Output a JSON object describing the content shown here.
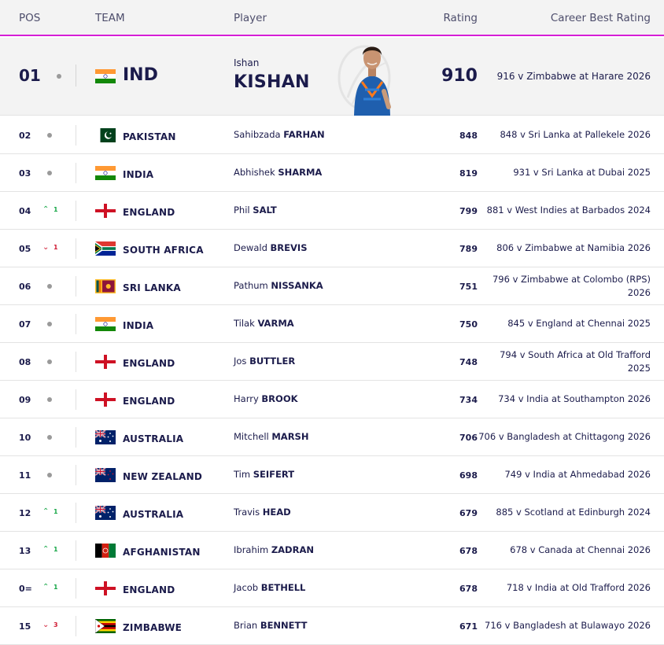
{
  "header": {
    "pos": "POS",
    "team": "TEAM",
    "player": "Player",
    "rating": "Rating",
    "best": "Career Best Rating"
  },
  "top": {
    "pos": "01",
    "team": "IND",
    "first": "Ishan",
    "last": "KISHAN",
    "rating": "910",
    "best": "916 v Zimbabwe at Harare 2026",
    "flag": "india"
  },
  "rows": [
    {
      "pos": "02",
      "move": "none",
      "change": "",
      "team": "PAKISTAN",
      "flag": "pakistan",
      "first": "Sahibzada",
      "last": "FARHAN",
      "rating": "848",
      "best": "848 v Sri Lanka at Pallekele 2026"
    },
    {
      "pos": "03",
      "move": "none",
      "change": "",
      "team": "INDIA",
      "flag": "india",
      "first": "Abhishek",
      "last": "SHARMA",
      "rating": "819",
      "best": "931 v Sri Lanka at Dubai 2025"
    },
    {
      "pos": "04",
      "move": "up",
      "change": "1",
      "team": "ENGLAND",
      "flag": "england",
      "first": "Phil",
      "last": "SALT",
      "rating": "799",
      "best": "881 v West Indies at Barbados 2024"
    },
    {
      "pos": "05",
      "move": "down",
      "change": "1",
      "team": "SOUTH AFRICA",
      "flag": "south-africa",
      "first": "Dewald",
      "last": "BREVIS",
      "rating": "789",
      "best": "806 v Zimbabwe at Namibia 2026"
    },
    {
      "pos": "06",
      "move": "none",
      "change": "",
      "team": "SRI LANKA",
      "flag": "sri-lanka",
      "first": "Pathum",
      "last": "NISSANKA",
      "rating": "751",
      "best": "796 v Zimbabwe at Colombo (RPS) 2026"
    },
    {
      "pos": "07",
      "move": "none",
      "change": "",
      "team": "INDIA",
      "flag": "india",
      "first": "Tilak",
      "last": "VARMA",
      "rating": "750",
      "best": "845 v England at Chennai 2025"
    },
    {
      "pos": "08",
      "move": "none",
      "change": "",
      "team": "ENGLAND",
      "flag": "england",
      "first": "Jos",
      "last": "BUTTLER",
      "rating": "748",
      "best": "794 v South Africa at Old Trafford 2025"
    },
    {
      "pos": "09",
      "move": "none",
      "change": "",
      "team": "ENGLAND",
      "flag": "england",
      "first": "Harry",
      "last": "BROOK",
      "rating": "734",
      "best": "734 v India at Southampton 2026"
    },
    {
      "pos": "10",
      "move": "none",
      "change": "",
      "team": "AUSTRALIA",
      "flag": "australia",
      "first": "Mitchell",
      "last": "MARSH",
      "rating": "706",
      "best": "706 v Bangladesh at Chittagong 2026"
    },
    {
      "pos": "11",
      "move": "none",
      "change": "",
      "team": "NEW ZEALAND",
      "flag": "new-zealand",
      "first": "Tim",
      "last": "SEIFERT",
      "rating": "698",
      "best": "749 v India at Ahmedabad 2026"
    },
    {
      "pos": "12",
      "move": "up",
      "change": "1",
      "team": "AUSTRALIA",
      "flag": "australia",
      "first": "Travis",
      "last": "HEAD",
      "rating": "679",
      "best": "885 v Scotland at Edinburgh 2024"
    },
    {
      "pos": "13",
      "move": "up",
      "change": "1",
      "team": "AFGHANISTAN",
      "flag": "afghanistan",
      "first": "Ibrahim",
      "last": "ZADRAN",
      "rating": "678",
      "best": "678 v Canada at Chennai 2026"
    },
    {
      "pos": "0=",
      "move": "up",
      "change": "1",
      "team": "ENGLAND",
      "flag": "england",
      "first": "Jacob",
      "last": "BETHELL",
      "rating": "678",
      "best": "718 v India at Old Trafford 2026"
    },
    {
      "pos": "15",
      "move": "down",
      "change": "3",
      "team": "ZIMBABWE",
      "flag": "zimbabwe",
      "first": "Brian",
      "last": "BENNETT",
      "rating": "671",
      "best": "716 v Bangladesh at Bulawayo 2026"
    }
  ],
  "colors": {
    "accent": "#d61ed6",
    "text": "#1b1b4b",
    "up": "#1aa84a",
    "down": "#d01d35"
  }
}
